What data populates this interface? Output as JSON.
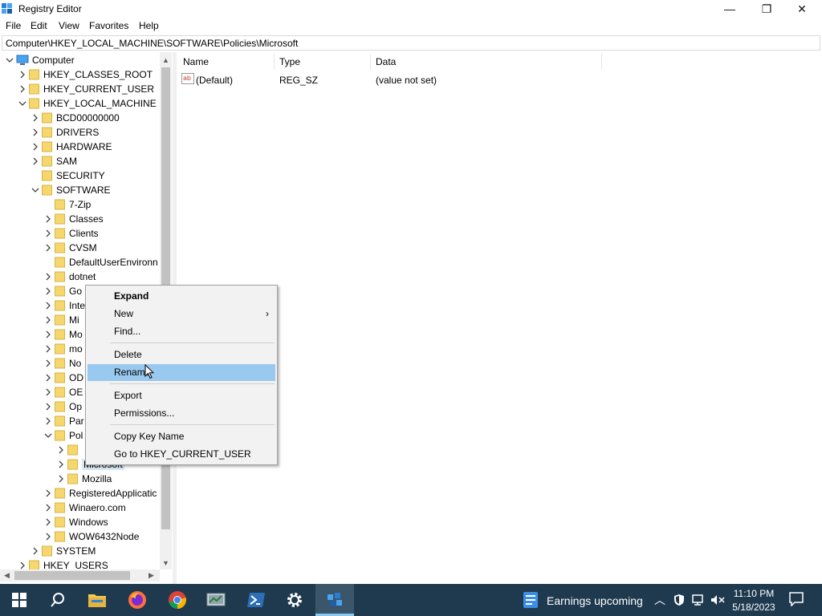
{
  "window": {
    "title": "Registry Editor",
    "minimize_glyph": "—",
    "maximize_glyph": "❐",
    "close_glyph": "✕"
  },
  "menu": {
    "items": [
      "File",
      "Edit",
      "View",
      "Favorites",
      "Help"
    ]
  },
  "address": {
    "path": "Computer\\HKEY_LOCAL_MACHINE\\SOFTWARE\\Policies\\Microsoft"
  },
  "tree": {
    "root": "Computer",
    "items": [
      "HKEY_CLASSES_ROOT",
      "HKEY_CURRENT_USER",
      "HKEY_LOCAL_MACHINE",
      "BCD00000000",
      "DRIVERS",
      "HARDWARE",
      "SAM",
      "SECURITY",
      "SOFTWARE",
      "7-Zip",
      "Classes",
      "Clients",
      "CVSM",
      "DefaultUserEnvironn",
      "dotnet",
      "Go",
      "Inte",
      "Mi",
      "Mo",
      "mo",
      "No",
      "OD",
      "OE",
      "Op",
      "Par",
      "Pol",
      "",
      "Microsoft",
      "Mozilla",
      "RegisteredApplicatic",
      "Winaero.com",
      "Windows",
      "WOW6432Node",
      "SYSTEM",
      "HKEY_USERS"
    ]
  },
  "list": {
    "columns": {
      "name": "Name",
      "type": "Type",
      "data": "Data"
    },
    "rows": [
      {
        "name": "(Default)",
        "type": "REG_SZ",
        "data": "(value not set)",
        "icon": "ab-string-icon"
      }
    ]
  },
  "context_menu": {
    "expand": "Expand",
    "new": "New",
    "find": "Find...",
    "delete": "Delete",
    "rename": "Rename",
    "export": "Export",
    "permissions": "Permissions...",
    "copy_key_name": "Copy Key Name",
    "goto_hkcu": "Go to HKEY_CURRENT_USER"
  },
  "taskbar": {
    "news": "Earnings upcoming",
    "time": "11:10 PM",
    "date": "5/18/2023",
    "icons": [
      "windows-start-icon",
      "search-icon",
      "file-explorer-icon",
      "firefox-icon",
      "chrome-icon",
      "control-panel-icon",
      "powershell-icon",
      "settings-gear-icon",
      "regedit-icon"
    ]
  },
  "colors": {
    "selection": "#99c9ef",
    "taskbar": "#1f3a4f",
    "folder": "#f5d76e"
  }
}
